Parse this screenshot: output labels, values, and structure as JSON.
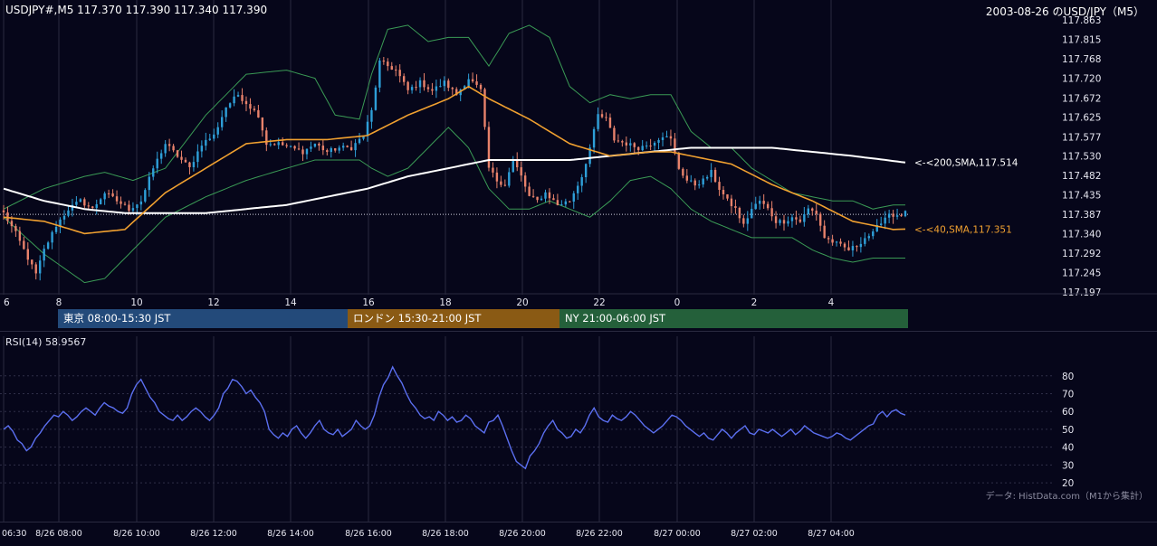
{
  "header": {
    "symbol_info": "USDJPY#,M5 117.370 117.390 117.340 117.390",
    "title_right": "2003-08-26 のUSD/JPY（M5）"
  },
  "sessions": [
    {
      "label": "東京 08:00-15:30 JST",
      "color": "#234a7a"
    },
    {
      "label": "ロンドン 15:30-21:00 JST",
      "color": "#8a5a14"
    },
    {
      "label": "NY 21:00-06:00 JST",
      "color": "#24603a"
    }
  ],
  "rsi": {
    "title": "RSI(14) 58.9567"
  },
  "credit": "データ: HistData.com（M1から集計）",
  "colors": {
    "background": "#06061a",
    "grid": "#2a2a40",
    "bull": "#2e9fd8",
    "bear": "#e8826b",
    "sma40": "#f0a030",
    "sma200": "#ffffff",
    "bollinger": "#3a9a55",
    "rsi": "#5b6ff0"
  },
  "chart_data": [
    {
      "type": "candlestick",
      "title": "USDJPY#,M5",
      "ylim": [
        117.197,
        117.863
      ],
      "yticks": [
        "117.863",
        "117.815",
        "117.768",
        "117.720",
        "117.672",
        "117.625",
        "117.577",
        "117.530",
        "117.482",
        "117.435",
        "117.387",
        "117.340",
        "117.292",
        "117.245",
        "117.197"
      ],
      "xticks": [
        "6",
        "8",
        "10",
        "12",
        "14",
        "16",
        "18",
        "20",
        "22",
        "0",
        "2",
        "4"
      ],
      "last_price": 117.387,
      "annotations": [
        {
          "label": "<-<200,SMA,117.514",
          "value": 117.514,
          "color": "#ffffff"
        },
        {
          "label": "<-<40,SMA,117.351",
          "value": 117.351,
          "color": "#f0a030"
        }
      ],
      "anchors": [
        [
          0,
          117.39
        ],
        [
          3,
          117.34
        ],
        [
          6,
          117.28
        ],
        [
          8,
          117.24
        ],
        [
          10,
          117.3
        ],
        [
          13,
          117.36
        ],
        [
          16,
          117.4
        ],
        [
          19,
          117.42
        ],
        [
          22,
          117.4
        ],
        [
          25,
          117.44
        ],
        [
          28,
          117.42
        ],
        [
          31,
          117.4
        ],
        [
          34,
          117.42
        ],
        [
          37,
          117.5
        ],
        [
          40,
          117.56
        ],
        [
          43,
          117.53
        ],
        [
          46,
          117.5
        ],
        [
          49,
          117.56
        ],
        [
          52,
          117.58
        ],
        [
          55,
          117.65
        ],
        [
          58,
          117.68
        ],
        [
          61,
          117.65
        ],
        [
          63,
          117.63
        ],
        [
          65,
          117.56
        ],
        [
          68,
          117.56
        ],
        [
          71,
          117.55
        ],
        [
          74,
          117.54
        ],
        [
          77,
          117.56
        ],
        [
          80,
          117.54
        ],
        [
          83,
          117.55
        ],
        [
          86,
          117.55
        ],
        [
          89,
          117.58
        ],
        [
          91,
          117.64
        ],
        [
          93,
          117.76
        ],
        [
          95,
          117.75
        ],
        [
          97,
          117.74
        ],
        [
          100,
          117.69
        ],
        [
          103,
          117.71
        ],
        [
          106,
          117.69
        ],
        [
          109,
          117.71
        ],
        [
          112,
          117.68
        ],
        [
          115,
          117.72
        ],
        [
          118,
          117.69
        ],
        [
          120,
          117.5
        ],
        [
          122,
          117.47
        ],
        [
          124,
          117.46
        ],
        [
          126,
          117.52
        ],
        [
          128,
          117.48
        ],
        [
          130,
          117.43
        ],
        [
          132,
          117.42
        ],
        [
          134,
          117.44
        ],
        [
          137,
          117.41
        ],
        [
          140,
          117.42
        ],
        [
          143,
          117.48
        ],
        [
          145,
          117.55
        ],
        [
          147,
          117.63
        ],
        [
          149,
          117.62
        ],
        [
          151,
          117.57
        ],
        [
          154,
          117.56
        ],
        [
          157,
          117.55
        ],
        [
          160,
          117.56
        ],
        [
          163,
          117.58
        ],
        [
          165,
          117.57
        ],
        [
          167,
          117.5
        ],
        [
          169,
          117.47
        ],
        [
          171,
          117.46
        ],
        [
          173,
          117.47
        ],
        [
          175,
          117.49
        ],
        [
          177,
          117.45
        ],
        [
          179,
          117.42
        ],
        [
          181,
          117.4
        ],
        [
          183,
          117.36
        ],
        [
          185,
          117.4
        ],
        [
          187,
          117.42
        ],
        [
          189,
          117.4
        ],
        [
          191,
          117.37
        ],
        [
          193,
          117.37
        ],
        [
          195,
          117.38
        ],
        [
          197,
          117.37
        ],
        [
          199,
          117.4
        ],
        [
          201,
          117.39
        ],
        [
          203,
          117.33
        ],
        [
          205,
          117.32
        ],
        [
          207,
          117.31
        ],
        [
          209,
          117.3
        ],
        [
          211,
          117.31
        ],
        [
          213,
          117.33
        ],
        [
          215,
          117.34
        ],
        [
          217,
          117.37
        ],
        [
          219,
          117.39
        ],
        [
          221,
          117.38
        ],
        [
          223,
          117.39
        ]
      ],
      "sma40": [
        [
          0,
          117.38
        ],
        [
          10,
          117.37
        ],
        [
          20,
          117.34
        ],
        [
          30,
          117.35
        ],
        [
          40,
          117.44
        ],
        [
          50,
          117.5
        ],
        [
          60,
          117.56
        ],
        [
          70,
          117.57
        ],
        [
          80,
          117.57
        ],
        [
          90,
          117.58
        ],
        [
          100,
          117.63
        ],
        [
          110,
          117.67
        ],
        [
          115,
          117.7
        ],
        [
          120,
          117.67
        ],
        [
          130,
          117.62
        ],
        [
          140,
          117.56
        ],
        [
          150,
          117.53
        ],
        [
          160,
          117.54
        ],
        [
          165,
          117.54
        ],
        [
          170,
          117.53
        ],
        [
          180,
          117.51
        ],
        [
          190,
          117.46
        ],
        [
          200,
          117.42
        ],
        [
          210,
          117.37
        ],
        [
          220,
          117.35
        ],
        [
          223,
          117.351
        ]
      ],
      "sma200": [
        [
          0,
          117.45
        ],
        [
          10,
          117.42
        ],
        [
          20,
          117.4
        ],
        [
          30,
          117.39
        ],
        [
          40,
          117.39
        ],
        [
          50,
          117.39
        ],
        [
          60,
          117.4
        ],
        [
          70,
          117.41
        ],
        [
          80,
          117.43
        ],
        [
          90,
          117.45
        ],
        [
          100,
          117.48
        ],
        [
          110,
          117.5
        ],
        [
          120,
          117.52
        ],
        [
          130,
          117.52
        ],
        [
          140,
          117.52
        ],
        [
          150,
          117.53
        ],
        [
          160,
          117.54
        ],
        [
          170,
          117.55
        ],
        [
          180,
          117.55
        ],
        [
          190,
          117.55
        ],
        [
          200,
          117.54
        ],
        [
          210,
          117.53
        ],
        [
          223,
          117.514
        ]
      ],
      "bollinger_upper": [
        [
          0,
          117.4
        ],
        [
          10,
          117.45
        ],
        [
          20,
          117.48
        ],
        [
          25,
          117.49
        ],
        [
          32,
          117.47
        ],
        [
          40,
          117.5
        ],
        [
          50,
          117.63
        ],
        [
          60,
          117.73
        ],
        [
          70,
          117.74
        ],
        [
          77,
          117.72
        ],
        [
          82,
          117.63
        ],
        [
          88,
          117.62
        ],
        [
          91,
          117.73
        ],
        [
          95,
          117.84
        ],
        [
          100,
          117.85
        ],
        [
          105,
          117.81
        ],
        [
          110,
          117.82
        ],
        [
          115,
          117.82
        ],
        [
          120,
          117.75
        ],
        [
          125,
          117.83
        ],
        [
          130,
          117.85
        ],
        [
          135,
          117.82
        ],
        [
          140,
          117.7
        ],
        [
          145,
          117.66
        ],
        [
          150,
          117.68
        ],
        [
          155,
          117.67
        ],
        [
          160,
          117.68
        ],
        [
          165,
          117.68
        ],
        [
          170,
          117.59
        ],
        [
          175,
          117.55
        ],
        [
          180,
          117.55
        ],
        [
          185,
          117.5
        ],
        [
          190,
          117.47
        ],
        [
          195,
          117.44
        ],
        [
          200,
          117.43
        ],
        [
          205,
          117.42
        ],
        [
          210,
          117.42
        ],
        [
          215,
          117.4
        ],
        [
          220,
          117.41
        ],
        [
          223,
          117.41
        ]
      ],
      "bollinger_lower": [
        [
          0,
          117.38
        ],
        [
          10,
          117.29
        ],
        [
          20,
          117.22
        ],
        [
          25,
          117.23
        ],
        [
          32,
          117.3
        ],
        [
          40,
          117.38
        ],
        [
          50,
          117.43
        ],
        [
          60,
          117.47
        ],
        [
          70,
          117.5
        ],
        [
          77,
          117.52
        ],
        [
          82,
          117.52
        ],
        [
          88,
          117.52
        ],
        [
          91,
          117.5
        ],
        [
          95,
          117.48
        ],
        [
          100,
          117.5
        ],
        [
          105,
          117.55
        ],
        [
          110,
          117.6
        ],
        [
          115,
          117.55
        ],
        [
          120,
          117.45
        ],
        [
          125,
          117.4
        ],
        [
          130,
          117.4
        ],
        [
          135,
          117.42
        ],
        [
          140,
          117.4
        ],
        [
          145,
          117.38
        ],
        [
          150,
          117.42
        ],
        [
          155,
          117.47
        ],
        [
          160,
          117.48
        ],
        [
          165,
          117.45
        ],
        [
          170,
          117.4
        ],
        [
          175,
          117.37
        ],
        [
          180,
          117.35
        ],
        [
          185,
          117.33
        ],
        [
          190,
          117.33
        ],
        [
          195,
          117.33
        ],
        [
          200,
          117.3
        ],
        [
          205,
          117.28
        ],
        [
          210,
          117.27
        ],
        [
          215,
          117.28
        ],
        [
          220,
          117.28
        ],
        [
          223,
          117.28
        ]
      ]
    },
    {
      "type": "line",
      "title": "RSI(14) 58.9567",
      "ylim": [
        17,
        88
      ],
      "yticks": [
        "80",
        "70",
        "60",
        "50",
        "40",
        "30",
        "20"
      ],
      "xticks": [
        "06:30",
        "8/26 08:00",
        "8/26 10:00",
        "8/26 12:00",
        "8/26 14:00",
        "8/26 16:00",
        "8/26 18:00",
        "8/26 20:00",
        "8/26 22:00",
        "8/27 00:00",
        "8/27 02:00",
        "8/27 04:00"
      ],
      "values": [
        50,
        52,
        49,
        44,
        42,
        38,
        40,
        45,
        48,
        52,
        55,
        58,
        57,
        60,
        58,
        55,
        57,
        60,
        62,
        60,
        58,
        62,
        65,
        63,
        62,
        60,
        59,
        62,
        70,
        75,
        78,
        73,
        68,
        65,
        60,
        58,
        56,
        55,
        58,
        55,
        57,
        60,
        62,
        60,
        57,
        55,
        58,
        62,
        70,
        73,
        78,
        77,
        74,
        70,
        72,
        68,
        65,
        60,
        50,
        47,
        45,
        48,
        46,
        50,
        52,
        48,
        45,
        48,
        52,
        55,
        50,
        48,
        47,
        50,
        46,
        48,
        50,
        55,
        52,
        50,
        52,
        58,
        68,
        75,
        79,
        85,
        80,
        76,
        70,
        65,
        62,
        58,
        56,
        57,
        55,
        60,
        58,
        55,
        57,
        54,
        55,
        58,
        56,
        52,
        50,
        48,
        54,
        55,
        58,
        52,
        45,
        38,
        32,
        30,
        28,
        35,
        38,
        42,
        48,
        52,
        55,
        50,
        48,
        45,
        46,
        50,
        48,
        52,
        58,
        62,
        57,
        55,
        54,
        58,
        56,
        55,
        57,
        60,
        58,
        55,
        52,
        50,
        48,
        50,
        52,
        55,
        58,
        57,
        55,
        52,
        50,
        48,
        46,
        48,
        45,
        44,
        47,
        50,
        48,
        45,
        48,
        50,
        52,
        48,
        47,
        50,
        49,
        48,
        50,
        48,
        46,
        48,
        50,
        47,
        49,
        52,
        50,
        48,
        47,
        46,
        45,
        46,
        48,
        47,
        45,
        44,
        46,
        48,
        50,
        52,
        53,
        58,
        60,
        57,
        60,
        61,
        59,
        58
      ]
    }
  ]
}
